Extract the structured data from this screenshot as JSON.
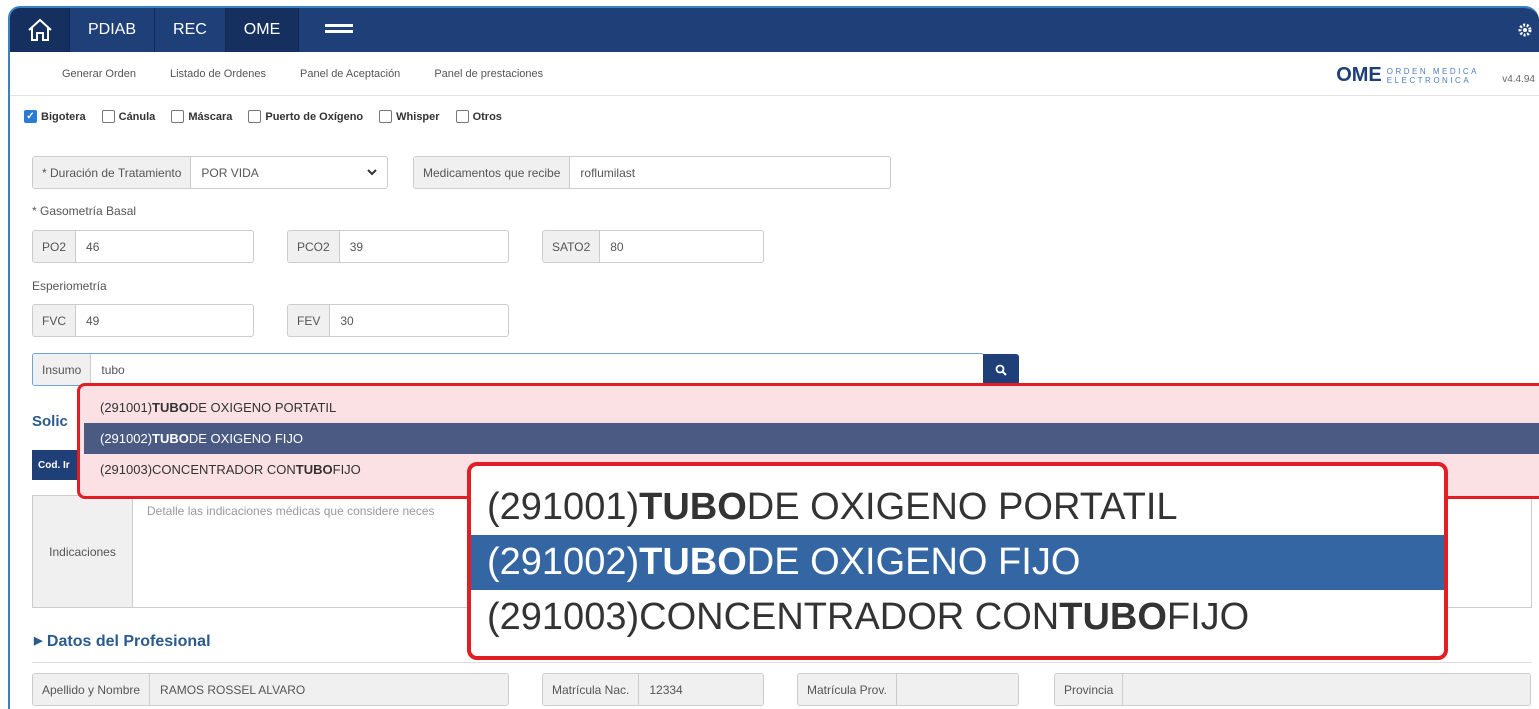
{
  "nav": {
    "tabs": [
      "PDIAB",
      "REC",
      "OME"
    ]
  },
  "subnav": {
    "items": [
      "Generar Orden",
      "Listado de Ordenes",
      "Panel de Aceptación",
      "Panel de prestaciones"
    ],
    "brand": "OME",
    "brand_sub_1": "ORDEN MEDICA",
    "brand_sub_2": "ELECTRONICA",
    "version": "v4.4.94"
  },
  "checkboxes": [
    {
      "label": "Bigotera",
      "checked": true
    },
    {
      "label": "Cánula",
      "checked": false
    },
    {
      "label": "Máscara",
      "checked": false
    },
    {
      "label": "Puerto de Oxígeno",
      "checked": false
    },
    {
      "label": "Whisper",
      "checked": false
    },
    {
      "label": "Otros",
      "checked": false
    }
  ],
  "form": {
    "duracion_label": "* Duración de Tratamiento",
    "duracion_value": "POR VIDA",
    "medicamentos_label": "Medicamentos que recibe",
    "medicamentos_value": "roflumilast",
    "gasometria_label": "* Gasometría Basal",
    "po2_label": "PO2",
    "po2_value": "46",
    "pco2_label": "PCO2",
    "pco2_value": "39",
    "sato2_label": "SATO2",
    "sato2_value": "80",
    "espirometria_label": "Esperiometría",
    "fvc_label": "FVC",
    "fvc_value": "49",
    "fev_label": "FEV",
    "fev_value": "30",
    "insumo_label": "Insumo",
    "insumo_value": "tubo"
  },
  "solicitud_title_partial": "Solic",
  "table_head_partial": "Cod. Ir",
  "indicaciones": {
    "label": "Indicaciones",
    "placeholder": "Detalle las indicaciones médicas que considere neces"
  },
  "profesional": {
    "title": "Datos del Profesional",
    "apellido_label": "Apellido y Nombre",
    "apellido_value": "RAMOS ROSSEL ALVARO",
    "mat_nac_label": "Matrícula Nac.",
    "mat_nac_value": "12334",
    "mat_prov_label": "Matrícula Prov.",
    "mat_prov_value": "",
    "provincia_label": "Provincia",
    "provincia_value": ""
  },
  "suggestions": [
    {
      "code": "(291001) ",
      "pre": "",
      "bold": "TUBO",
      "post": " DE OXIGENO PORTATIL",
      "selected": false
    },
    {
      "code": "(291002) ",
      "pre": "",
      "bold": "TUBO",
      "post": " DE OXIGENO FIJO",
      "selected": true
    },
    {
      "code": "(291003) ",
      "pre": "CONCENTRADOR CON ",
      "bold": "TUBO",
      "post": " FIJO",
      "selected": false
    }
  ],
  "colors": {
    "navbar": "#1e3f78",
    "highlight": "#e01e24",
    "selected": "#3466a3"
  }
}
